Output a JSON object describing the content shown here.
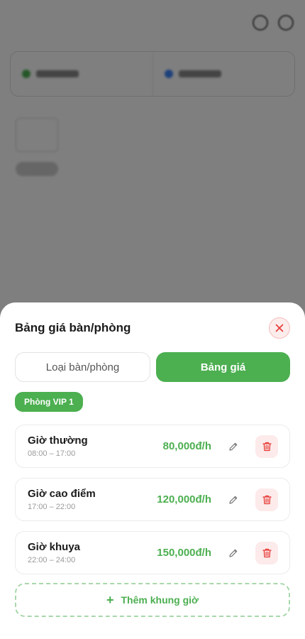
{
  "sheet": {
    "title": "Bảng giá bàn/phòng",
    "tabs": [
      {
        "label": "Loại bàn/phòng",
        "active": false
      },
      {
        "label": "Bảng giá",
        "active": true
      }
    ],
    "room_chip": "Phòng VIP 1",
    "prices": [
      {
        "name": "Giờ thường",
        "time": "08:00 – 17:00",
        "price": "80,000đ/h"
      },
      {
        "name": "Giờ cao điểm",
        "time": "17:00 – 22:00",
        "price": "120,000đ/h"
      },
      {
        "name": "Giờ khuya",
        "time": "22:00 – 24:00",
        "price": "150,000đ/h"
      }
    ],
    "add_label": "Thêm khung giờ"
  },
  "colors": {
    "accent": "#4caf50",
    "danger": "#e53935",
    "danger_bg": "#fdeaea"
  },
  "icons": {
    "close": "close-icon",
    "edit": "pencil-icon",
    "delete": "trash-icon",
    "add": "plus-icon"
  }
}
